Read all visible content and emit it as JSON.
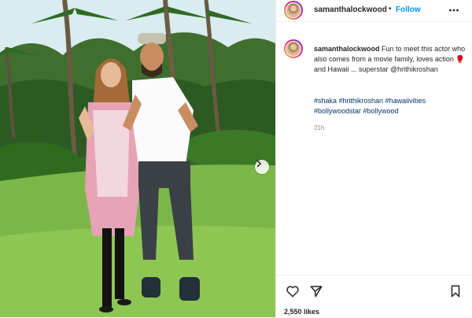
{
  "post": {
    "username": "samanthalockwood",
    "follow_label": "Follow",
    "separator": "•",
    "caption_text": "Fun to meet this actor who also comes from a movie family, loves action 🥊 and Hawaii ... superstar @hrithikroshan",
    "hashtags": "#shaka #hrithikroshan #hawaiivibes #bollywoodstar #bollywood",
    "timestamp": "21h",
    "likes": "2,550 likes"
  },
  "icons": {
    "more": "more-options-icon",
    "next": "chevron-right-icon",
    "like": "heart-icon",
    "share": "send-icon",
    "save": "bookmark-icon"
  },
  "colors": {
    "follow": "#0095f6",
    "hashtag": "#00376b",
    "text": "#262626",
    "muted": "#8e8e8e"
  }
}
